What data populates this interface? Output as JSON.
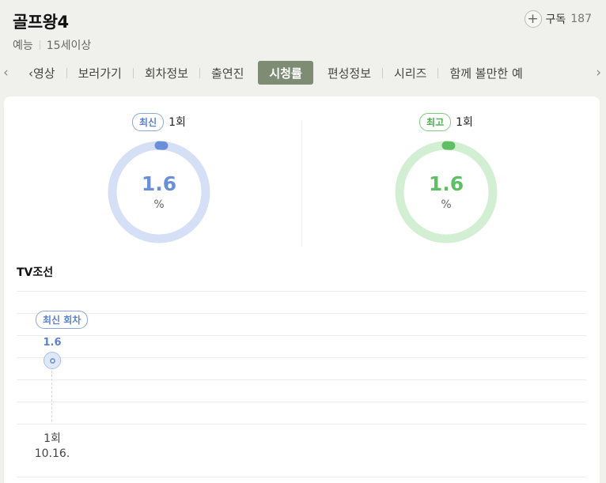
{
  "program": {
    "title": "골프왕4",
    "genre": "예능",
    "rating": "15세이상"
  },
  "subscribe": {
    "label": "구독",
    "count": "187"
  },
  "tabs": [
    {
      "label": "‹영상",
      "active": false
    },
    {
      "label": "보러가기",
      "active": false
    },
    {
      "label": "회차정보",
      "active": false
    },
    {
      "label": "출연진",
      "active": false
    },
    {
      "label": "시청률",
      "active": true
    },
    {
      "label": "편성정보",
      "active": false
    },
    {
      "label": "시리즈",
      "active": false
    },
    {
      "label": "함께 볼만한 예",
      "active": false
    }
  ],
  "gauges": {
    "latest": {
      "badge": "최신",
      "episode": "1회",
      "value": "1.6",
      "unit": "%",
      "color": "#6a8fd8",
      "track": "#d5e0f6"
    },
    "best": {
      "badge": "최고",
      "episode": "1회",
      "value": "1.6",
      "unit": "%",
      "color": "#5fbf64",
      "track": "#d3efd3"
    }
  },
  "chart": {
    "channel": "TV조선",
    "latest_badge": "최신 회차"
  },
  "chart_data": {
    "type": "line",
    "series": [
      {
        "values": [
          1.6
        ]
      }
    ],
    "categories": [
      "1회 10.16."
    ],
    "episodes": [
      {
        "episode": "1회",
        "date": "10.16.",
        "value": "1.6"
      }
    ]
  },
  "icons": {
    "plus": "plus-icon",
    "left": "chevron-left-icon",
    "right": "chevron-right-icon"
  }
}
